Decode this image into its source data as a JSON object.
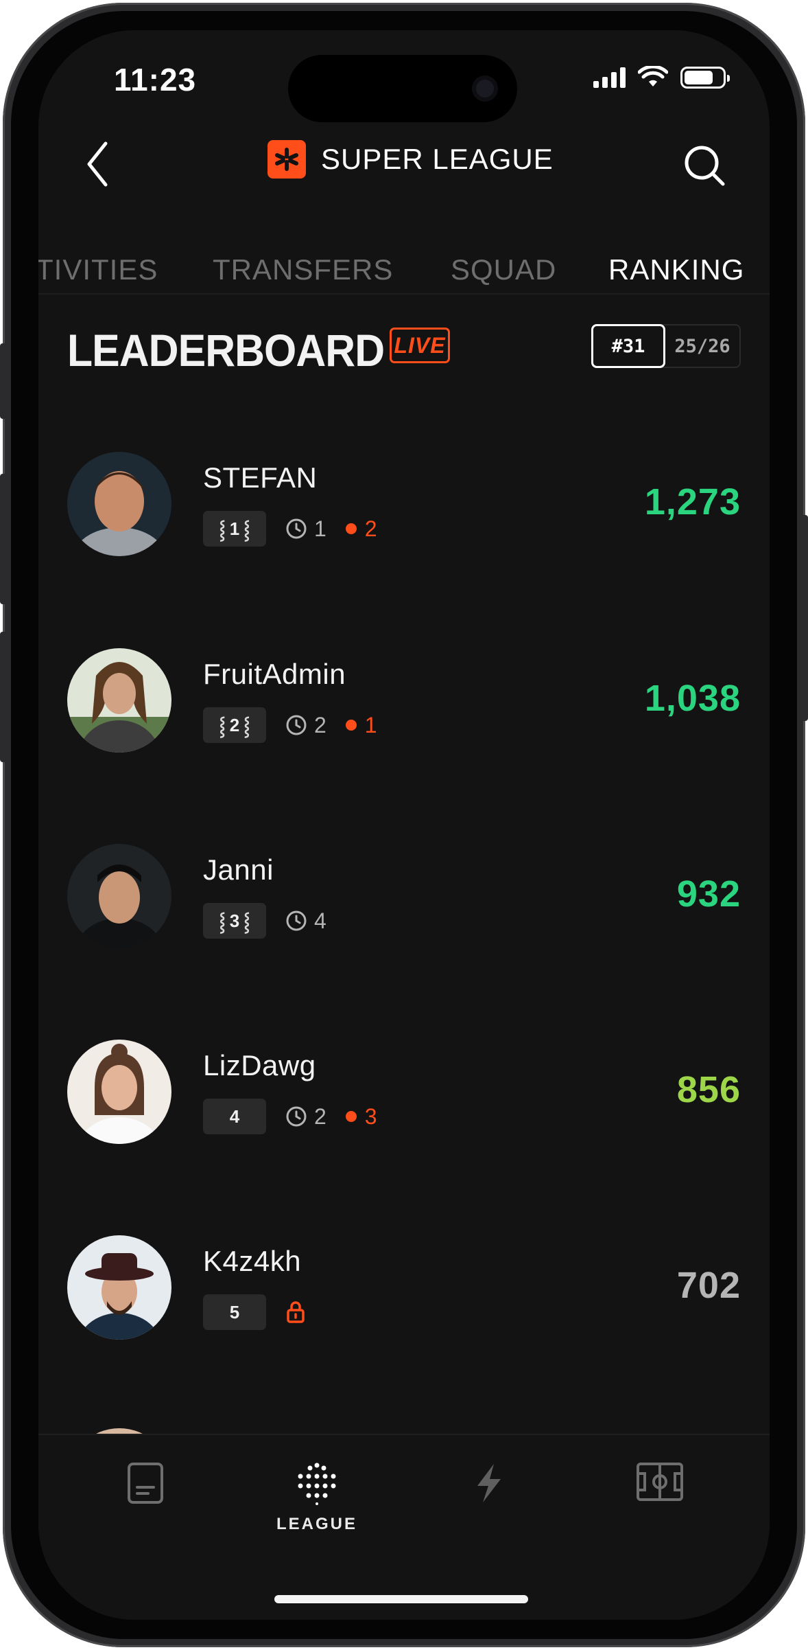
{
  "status": {
    "time": "11:23"
  },
  "header": {
    "title": "SUPER LEAGUE"
  },
  "tabs": [
    {
      "label": "TIVITIES",
      "active": false
    },
    {
      "label": "TRANSFERS",
      "active": false
    },
    {
      "label": "SQUAD",
      "active": false
    },
    {
      "label": "RANKING",
      "active": true
    }
  ],
  "leaderboard": {
    "title": "LEADERBOARD",
    "live_label": "LIVE",
    "segment_rank": "#31",
    "segment_season": "25/26",
    "rows": [
      {
        "name": "STEFAN",
        "rank": "1",
        "clock": "1",
        "live": "2",
        "score": "1,273",
        "score_color": "#2bd47e"
      },
      {
        "name": "FruitAdmin",
        "rank": "2",
        "clock": "2",
        "live": "1",
        "score": "1,038",
        "score_color": "#2bd47e"
      },
      {
        "name": "Janni",
        "rank": "3",
        "clock": "4",
        "live": "",
        "score": "932",
        "score_color": "#2bd47e"
      },
      {
        "name": "LizDawg",
        "rank": "4",
        "clock": "2",
        "live": "3",
        "score": "856",
        "score_color": "#9ed64a"
      },
      {
        "name": "K4z4kh",
        "rank": "5",
        "clock": "",
        "live": "",
        "score": "702",
        "score_color": "#b5b5b5"
      }
    ]
  },
  "bottom_nav": {
    "items": [
      {
        "icon": "document-icon",
        "label": ""
      },
      {
        "icon": "league-dots-icon",
        "label": "LEAGUE"
      },
      {
        "icon": "lightning-icon",
        "label": ""
      },
      {
        "icon": "pitch-icon",
        "label": ""
      }
    ]
  },
  "colors": {
    "accent": "#ff4e1a",
    "background": "#131313",
    "positive": "#2bd47e"
  }
}
